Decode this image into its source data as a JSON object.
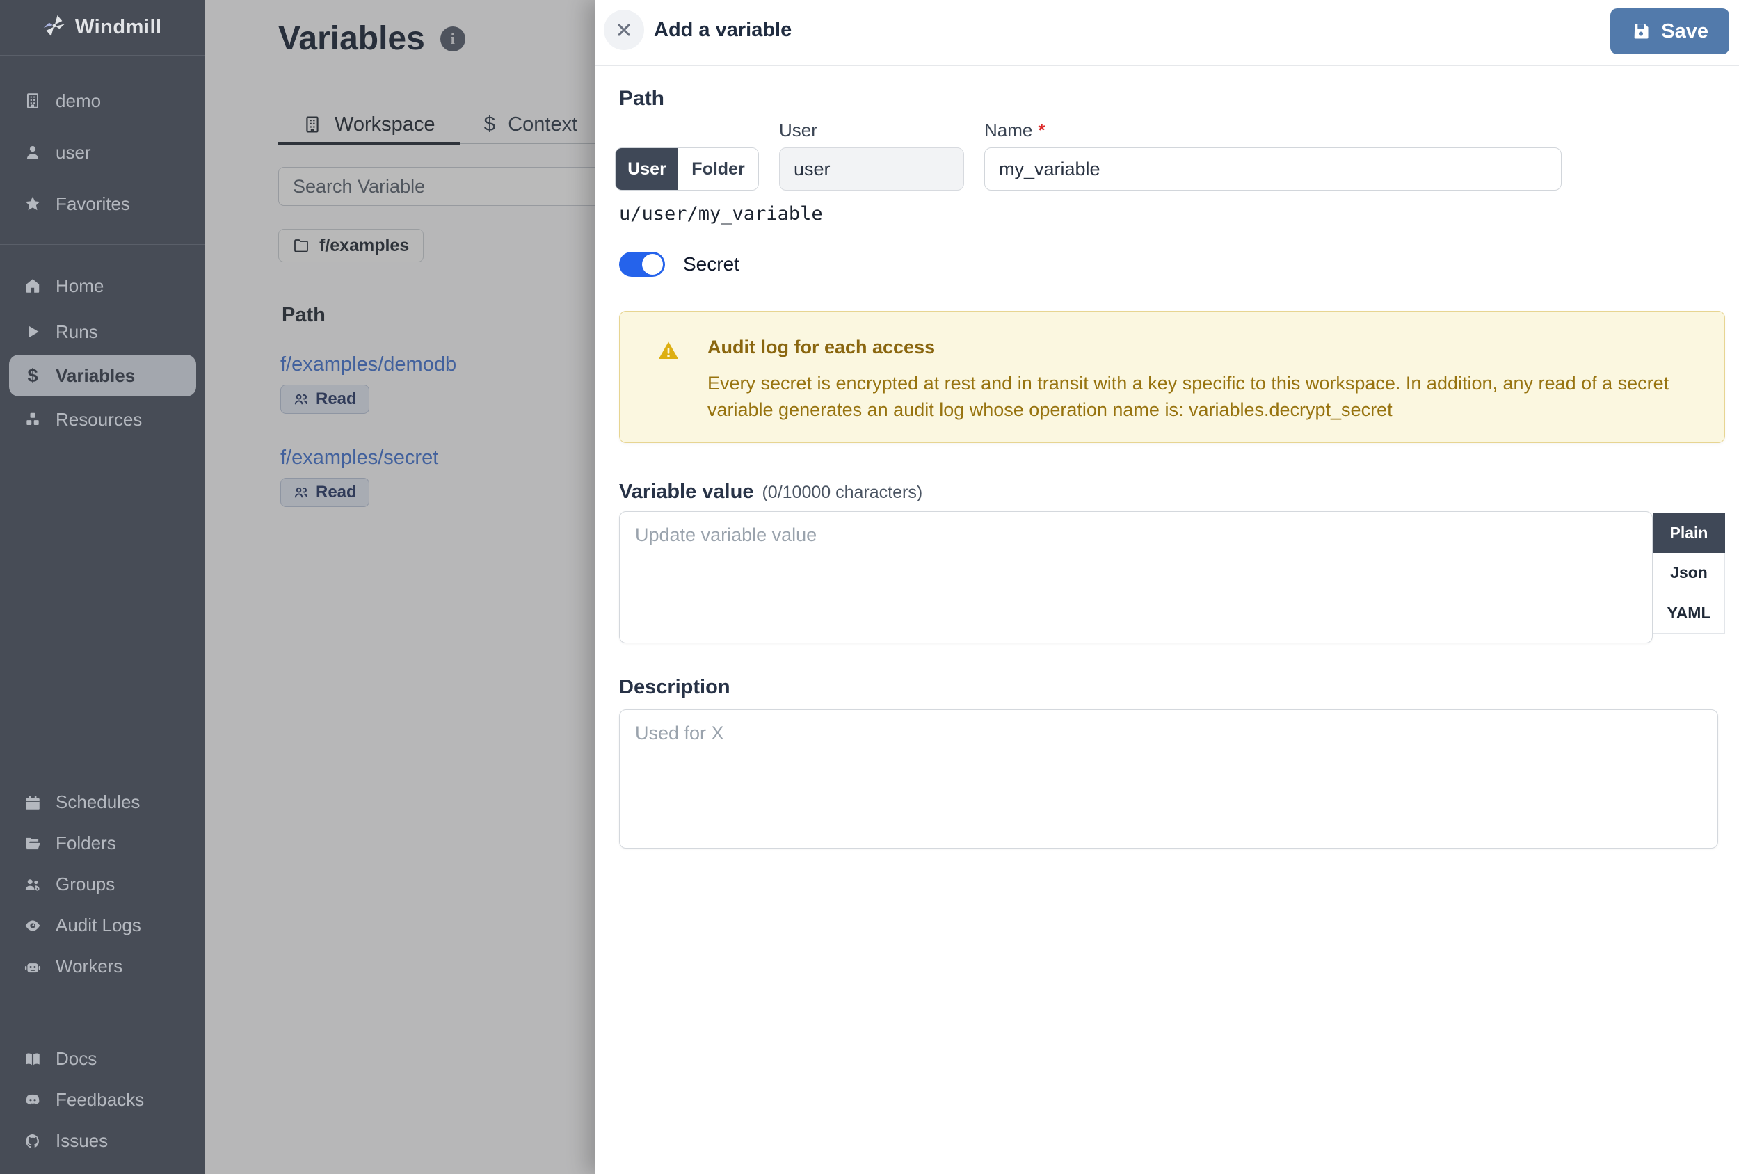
{
  "app": {
    "name": "Windmill"
  },
  "sidebar": {
    "workspace_items": [
      {
        "label": "demo",
        "icon": "building"
      },
      {
        "label": "user",
        "icon": "person"
      },
      {
        "label": "Favorites",
        "icon": "star"
      }
    ],
    "nav_items": [
      {
        "label": "Home",
        "icon": "home",
        "active": false
      },
      {
        "label": "Runs",
        "icon": "play",
        "active": false
      },
      {
        "label": "Variables",
        "icon": "dollar",
        "active": true
      },
      {
        "label": "Resources",
        "icon": "cubes",
        "active": false
      }
    ],
    "admin_items": [
      {
        "label": "Schedules",
        "icon": "calendar"
      },
      {
        "label": "Folders",
        "icon": "folder-open"
      },
      {
        "label": "Groups",
        "icon": "users-gear"
      },
      {
        "label": "Audit Logs",
        "icon": "eye"
      },
      {
        "label": "Workers",
        "icon": "robot"
      }
    ],
    "footer_items": [
      {
        "label": "Docs",
        "icon": "book"
      },
      {
        "label": "Feedbacks",
        "icon": "discord"
      },
      {
        "label": "Issues",
        "icon": "github"
      }
    ]
  },
  "main": {
    "title": "Variables",
    "tabs": [
      {
        "label": "Workspace",
        "icon": "building",
        "active": true
      },
      {
        "label": "Context",
        "icon": "dollar",
        "active": false
      }
    ],
    "search_placeholder": "Search Variable",
    "folder_chip": "f/examples",
    "table": {
      "path_header": "Path",
      "rows": [
        {
          "path": "f/examples/demodb",
          "badge": "Read"
        },
        {
          "path": "f/examples/secret",
          "badge": "Read"
        }
      ]
    }
  },
  "drawer": {
    "title": "Add a variable",
    "save_label": "Save",
    "path_section": {
      "heading": "Path",
      "owner_toggle": {
        "options": [
          "User",
          "Folder"
        ],
        "selected": "User"
      },
      "user_label": "User",
      "user_value": "user",
      "name_label": "Name",
      "required_marker": "*",
      "name_value": "my_variable",
      "full_path": "u/user/my_variable"
    },
    "secret_toggle": {
      "label": "Secret",
      "state": "on"
    },
    "warning": {
      "title": "Audit log for each access",
      "body": "Every secret is encrypted at rest and in transit with a key specific to this workspace. In addition, any read of a secret variable generates an audit log whose operation name is: variables.decrypt_secret"
    },
    "value_section": {
      "heading": "Variable value",
      "counter": "(0/10000 characters)",
      "placeholder": "Update variable value",
      "formats": [
        "Plain",
        "Json",
        "YAML"
      ],
      "selected_format": "Plain"
    },
    "description_section": {
      "heading": "Description",
      "placeholder": "Used for X"
    }
  },
  "colors": {
    "sidebar_bg": "#474c56",
    "save_button": "#527aab",
    "secret_toggle_on": "#2563eb",
    "warning_bg": "#fbf7e0",
    "warning_text": "#97730f",
    "link_blue": "#5b86d7",
    "active_segment_bg": "#3f4857"
  }
}
